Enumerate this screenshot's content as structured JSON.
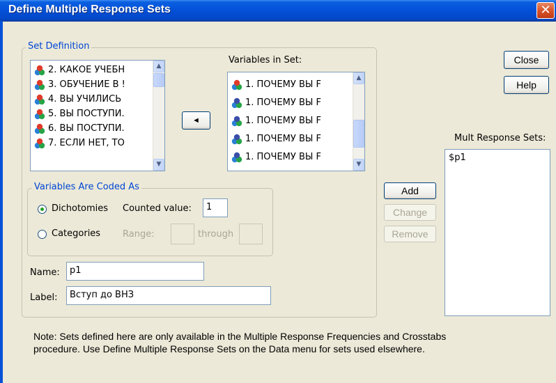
{
  "window": {
    "title": "Define Multiple Response Sets",
    "close_glyph": "✕"
  },
  "set_definition": {
    "legend": "Set Definition",
    "source_list": [
      "2. КАКОЕ УЧЕБН",
      "3. ОБУЧЕНИЕ В !",
      "4. ВЫ УЧИЛИСЬ",
      "5. ВЫ ПОСТУПИ.",
      "6. ВЫ ПОСТУПИ.",
      "7. ЕСЛИ НЕТ, ТО"
    ],
    "move_button_glyph": "◄",
    "variables_in_set_label": "Variables in Set:",
    "variables_in_set": [
      "1. ПОЧЕМУ ВЫ F",
      "1. ПОЧЕМУ ВЫ F",
      "1. ПОЧЕМУ ВЫ F",
      "1. ПОЧЕМУ ВЫ F",
      "1. ПОЧЕМУ ВЫ F"
    ],
    "coded_as": {
      "legend": "Variables Are Coded As",
      "dichotomies_label": "Dichotomies",
      "counted_value_label": "Counted value:",
      "counted_value": "1",
      "categories_label": "Categories",
      "range_label": "Range:",
      "through_label": "through",
      "range_from": "",
      "range_to": "",
      "selected": "Dichotomies"
    },
    "name_label": "Name:",
    "name_value": "p1",
    "label_label": "Label:",
    "label_value": "Вступ до ВНЗ"
  },
  "buttons": {
    "add": "Add",
    "change": "Change",
    "remove": "Remove",
    "close": "Close",
    "help": "Help"
  },
  "mult_response": {
    "label": "Mult Response Sets:",
    "items": [
      "$p1"
    ]
  },
  "note": {
    "line1": "Note: Sets defined here are only available in the Multiple Response Frequencies and Crosstabs",
    "line2": "procedure.  Use  Define Multiple Response Sets on the Data menu for sets used elsewhere."
  },
  "colors": {
    "title_bar": "#0450d8",
    "dialog_bg": "#ece9d8",
    "group_label": "#0046d5",
    "close_button": "#d8542a"
  },
  "icons": {
    "variable": "nominal-variable-icon",
    "scale_variable": "scale-variable-icon"
  }
}
